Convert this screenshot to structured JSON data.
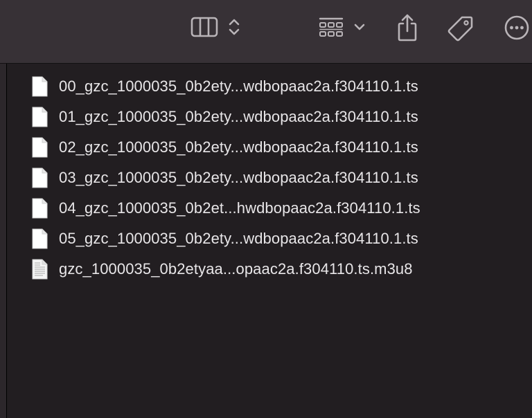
{
  "toolbar": {
    "buttons": [
      {
        "name": "column-view-icon"
      },
      {
        "name": "view-options-chevron-icon"
      },
      {
        "name": "group-by-icon"
      },
      {
        "name": "chevron-down-icon"
      },
      {
        "name": "share-icon"
      },
      {
        "name": "tag-icon"
      },
      {
        "name": "more-icon"
      }
    ]
  },
  "files": [
    {
      "name": "00_gzc_1000035_0b2ety...wdbopaac2a.f304110.1.ts",
      "icon": "blank-document-icon"
    },
    {
      "name": "01_gzc_1000035_0b2ety...wdbopaac2a.f304110.1.ts",
      "icon": "blank-document-icon"
    },
    {
      "name": "02_gzc_1000035_0b2ety...wdbopaac2a.f304110.1.ts",
      "icon": "blank-document-icon"
    },
    {
      "name": "03_gzc_1000035_0b2ety...wdbopaac2a.f304110.1.ts",
      "icon": "blank-document-icon"
    },
    {
      "name": "04_gzc_1000035_0b2et...hwdbopaac2a.f304110.1.ts",
      "icon": "blank-document-icon"
    },
    {
      "name": "05_gzc_1000035_0b2ety...wdbopaac2a.f304110.1.ts",
      "icon": "blank-document-icon"
    },
    {
      "name": "gzc_1000035_0b2etyaa...opaac2a.f304110.ts.m3u8",
      "icon": "text-document-icon"
    }
  ]
}
